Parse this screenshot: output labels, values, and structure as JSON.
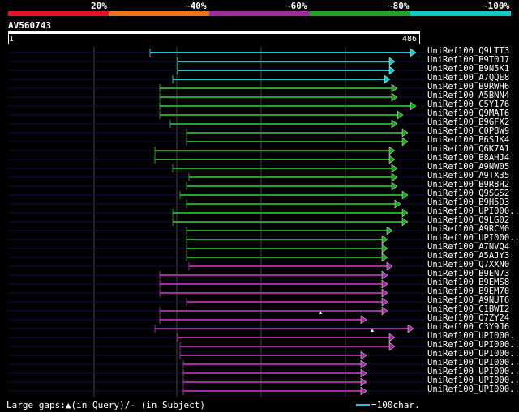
{
  "scale": {
    "labels": [
      "20%",
      "~40%",
      "~60%",
      "~80%",
      "~100%"
    ],
    "colors": [
      "#e8102a",
      "#e8761c",
      "#a02ca0",
      "#22a422",
      "#16c8c8"
    ]
  },
  "accession": "AV560743",
  "query": {
    "start": "1",
    "end": "486"
  },
  "hits": [
    {
      "label": "UniRef100_Q9LTT3",
      "color": "#16c8c8"
    },
    {
      "label": "UniRef100_B9T0J7",
      "color": "#16c8c8"
    },
    {
      "label": "UniRef100_B9N5K1",
      "color": "#16c8c8"
    },
    {
      "label": "UniRef100_A7QQE8",
      "color": "#16c8c8"
    },
    {
      "label": "UniRef100_B9RWH6",
      "color": "#22a422"
    },
    {
      "label": "UniRef100_A5BNN4",
      "color": "#22a422"
    },
    {
      "label": "UniRef100_C5Y176",
      "color": "#22a422"
    },
    {
      "label": "UniRef100_Q9MAT6",
      "color": "#22a422"
    },
    {
      "label": "UniRef100_B9GFX2",
      "color": "#22a422"
    },
    {
      "label": "UniRef100_C0P8W9",
      "color": "#22a422"
    },
    {
      "label": "UniRef100_B6SJK4",
      "color": "#22a422"
    },
    {
      "label": "UniRef100_Q6K7A1",
      "color": "#22a422"
    },
    {
      "label": "UniRef100_B8AHJ4",
      "color": "#22a422"
    },
    {
      "label": "UniRef100_A9NW05",
      "color": "#22a422"
    },
    {
      "label": "UniRef100_A9TX35",
      "color": "#22a422"
    },
    {
      "label": "UniRef100_B9R8H2",
      "color": "#22a422"
    },
    {
      "label": "UniRef100_Q9SGS2",
      "color": "#22a422"
    },
    {
      "label": "UniRef100_B9H5D3",
      "color": "#22a422"
    },
    {
      "label": "UniRef100_UPI000..",
      "color": "#22a422"
    },
    {
      "label": "UniRef100_Q9LG02",
      "color": "#22a422"
    },
    {
      "label": "UniRef100_A9RCM0",
      "color": "#22a422"
    },
    {
      "label": "UniRef100_UPI000..",
      "color": "#22a422"
    },
    {
      "label": "UniRef100_A7NVQ4",
      "color": "#22a422"
    },
    {
      "label": "UniRef100_A5AJY3",
      "color": "#22a422"
    },
    {
      "label": "UniRef100_Q7XXN0",
      "color": "#a02ca0"
    },
    {
      "label": "UniRef100_B9EN73",
      "color": "#a02ca0"
    },
    {
      "label": "UniRef100_B9EMS8",
      "color": "#a02ca0"
    },
    {
      "label": "UniRef100_B9EM70",
      "color": "#a02ca0"
    },
    {
      "label": "UniRef100_A9NUT6",
      "color": "#a02ca0"
    },
    {
      "label": "UniRef100_C1BWI2",
      "color": "#a02ca0"
    },
    {
      "label": "UniRef100_Q7ZY24",
      "color": "#a02ca0"
    },
    {
      "label": "UniRef100_C3Y9J6",
      "color": "#a02ca0"
    },
    {
      "label": "UniRef100_UPI000..",
      "color": "#a02ca0"
    },
    {
      "label": "UniRef100_UPI000..",
      "color": "#a02ca0"
    },
    {
      "label": "UniRef100_UPI000..",
      "color": "#a02ca0"
    },
    {
      "label": "UniRef100_UPI000..",
      "color": "#a02ca0"
    },
    {
      "label": "UniRef100_UPI000..",
      "color": "#a02ca0"
    },
    {
      "label": "UniRef100_UPI000..",
      "color": "#a02ca0"
    },
    {
      "label": "UniRef100_UPI000..",
      "color": "#a02ca0"
    }
  ],
  "footer": {
    "gaps_text": "Large gaps:▲(in Query)/- (in Subject)",
    "legend_text": "=100char.",
    "legend_color": "#16c8c8"
  }
}
